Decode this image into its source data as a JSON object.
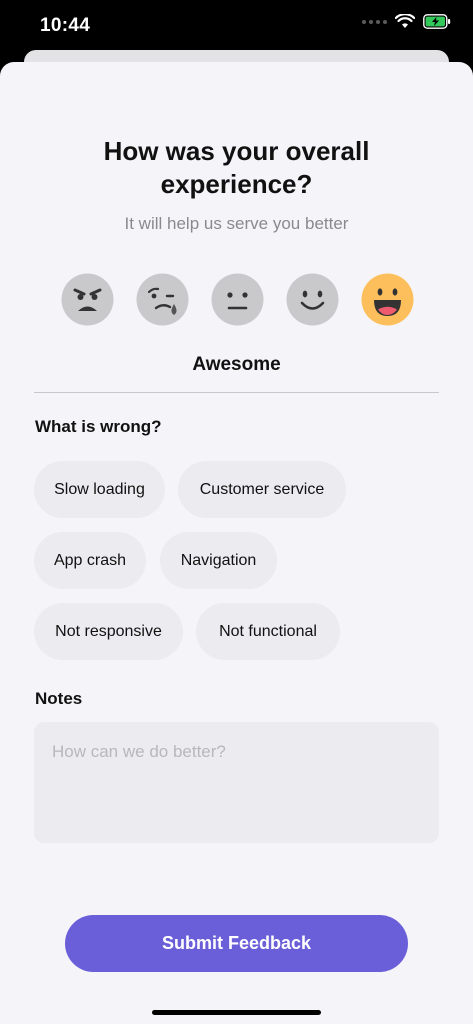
{
  "status_bar": {
    "time": "10:44"
  },
  "header": {
    "title_line1": "How was your overall",
    "title_line2": "experience?",
    "subtitle": "It will help us serve you better"
  },
  "rating": {
    "options": [
      "angry",
      "sad",
      "neutral",
      "happy",
      "awesome"
    ],
    "selected": "awesome",
    "selected_label": "Awesome",
    "accent_color": "#fdbf5b"
  },
  "issues": {
    "title": "What is wrong?",
    "chips": [
      "Slow loading",
      "Customer service",
      "App crash",
      "Navigation",
      "Not responsive",
      "Not functional"
    ]
  },
  "notes": {
    "title": "Notes",
    "placeholder": "How can we do better?",
    "value": ""
  },
  "submit": {
    "label": "Submit Feedback",
    "color": "#6b5fd9"
  }
}
